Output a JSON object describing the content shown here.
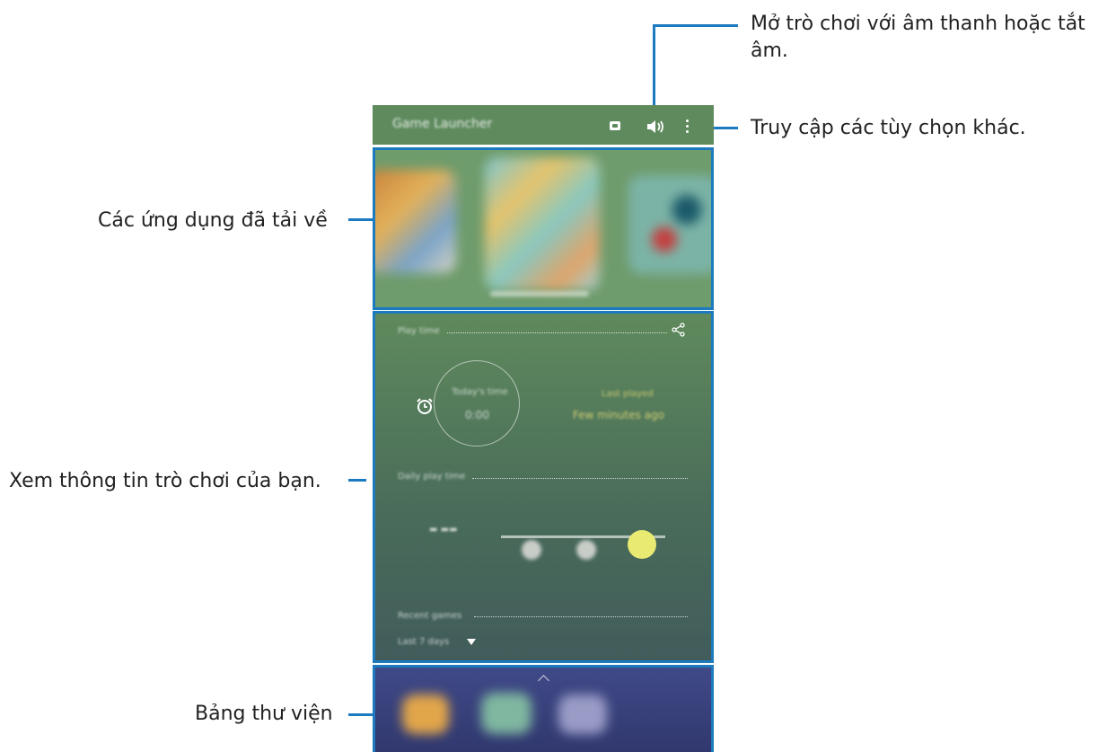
{
  "callouts": {
    "sound": "Mở trò chơi với âm thanh hoặc tắt âm.",
    "sound_line1": "Mở trò chơi với âm thanh hoặc tắt",
    "sound_line2": "âm.",
    "more": "Truy cập các tùy chọn khác.",
    "downloaded": "Các ứng dụng đã tải về",
    "info": "Xem thông tin trò chơi của bạn.",
    "library": "Bảng thư viện"
  },
  "app_bar": {
    "title": "Game Launcher",
    "icons": [
      "discord-icon",
      "volume-icon",
      "more-options-icon"
    ]
  },
  "play_time": {
    "section_label": "Play time",
    "today_label": "Today's time",
    "today_value": "0:00",
    "last_label": "Last played",
    "last_value": "Few minutes ago",
    "daily_label": "Daily play time",
    "recent_label": "Recent games",
    "range": "Last 7 days"
  },
  "colors": {
    "accent": "#1b7ac0",
    "app_bar": "#5e8a5e",
    "slider_active": "#e9ea72"
  }
}
